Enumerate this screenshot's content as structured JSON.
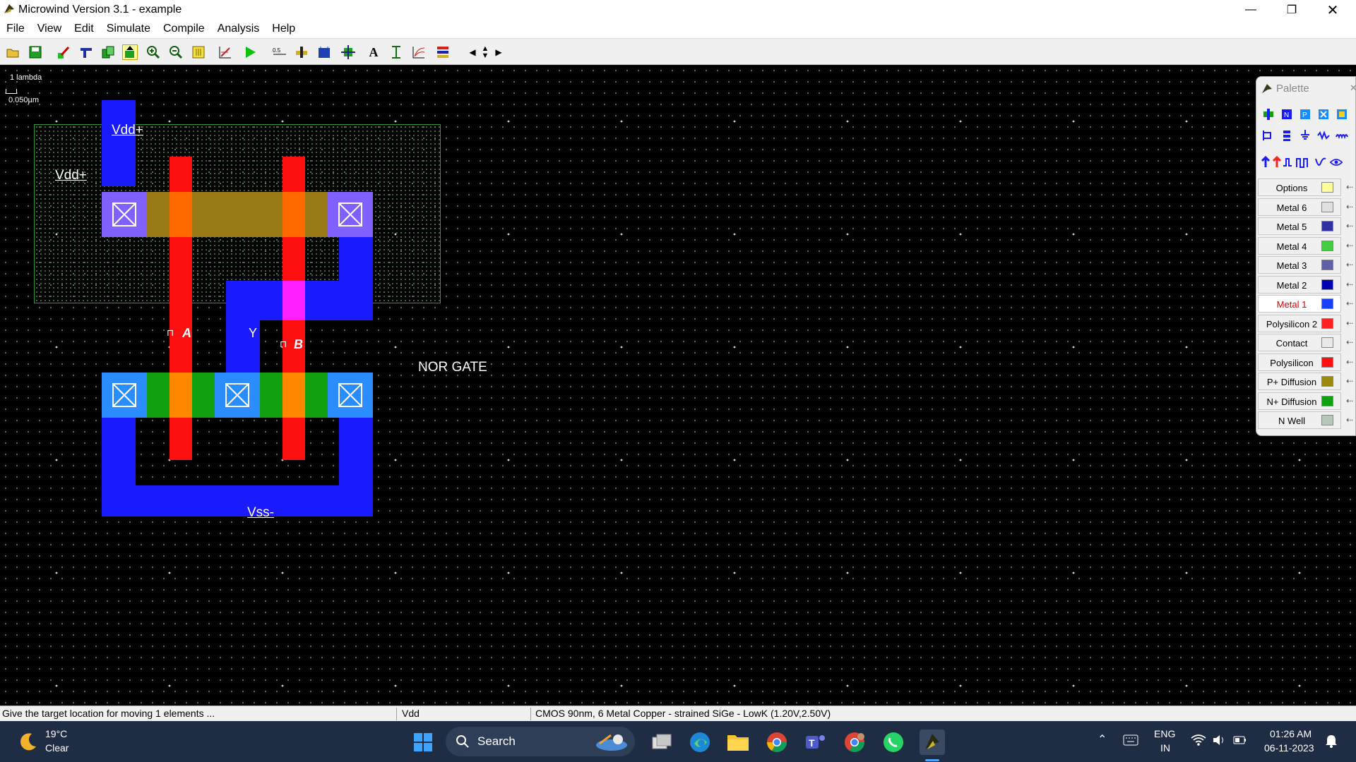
{
  "window": {
    "title": "Microwind Version 3.1 - example"
  },
  "menu": [
    "File",
    "View",
    "Edit",
    "Simulate",
    "Compile",
    "Analysis",
    "Help"
  ],
  "toolbar_icons": [
    "open-icon",
    "save-icon",
    "edit-icon",
    "connect-icon",
    "copy-icon",
    "move-icon",
    "zoom-in-icon",
    "zoom-out-icon",
    "view-all-icon",
    "2d-view-icon",
    "run-icon",
    "measure-icon",
    "mos-generator-icon",
    "3d-view-icon",
    "process-icon",
    "text-icon",
    "vertical-aspect-icon",
    "ports-icon",
    "cut-icon",
    "scroll-left-icon",
    "scroll-up-down-icon",
    "scroll-right-icon"
  ],
  "scale": {
    "lambda": "1 lambda",
    "micron": "0.050µm"
  },
  "layout_labels": {
    "vdd_top": "Vdd+",
    "vdd_left": "Vdd+",
    "input_a": "A",
    "output_y": "Y",
    "input_b": "B",
    "vss": "Vss-",
    "title": "NOR GATE"
  },
  "palette": {
    "title": "Palette",
    "items": [
      {
        "label": "Options",
        "color": "#ffff99"
      },
      {
        "label": "Metal 6",
        "color": "#e0e0e0"
      },
      {
        "label": "Metal 5",
        "color": "#3030a0"
      },
      {
        "label": "Metal 4",
        "color": "#44cc44"
      },
      {
        "label": "Metal 3",
        "color": "#6060a8"
      },
      {
        "label": "Metal 2",
        "color": "#0000b0"
      },
      {
        "label": "Metal 1",
        "color": "#1a40ff"
      },
      {
        "label": "Polysilicon 2",
        "color": "#ff2020"
      },
      {
        "label": "Contact",
        "color": "#e8e8e8"
      },
      {
        "label": "Polysilicon",
        "color": "#ff1010"
      },
      {
        "label": "P+ Diffusion",
        "color": "#9a8a10"
      },
      {
        "label": "N+ Diffusion",
        "color": "#10a010"
      },
      {
        "label": "N Well",
        "color": "#b8c8b8"
      }
    ],
    "selected": "Metal 1"
  },
  "status": {
    "message": "Give the target location for moving 1 elements ...",
    "node": "Vdd",
    "technology": "CMOS 90nm, 6 Metal Copper - strained SiGe - LowK (1.20V,2.50V)"
  },
  "taskbar": {
    "weather_temp": "19°C",
    "weather_desc": "Clear",
    "search": "Search",
    "lang_top": "ENG",
    "lang_bottom": "IN",
    "time": "01:26 AM",
    "date": "06-11-2023"
  },
  "colors": {
    "metal1": "#1a1aff",
    "poly": "#ff1010",
    "ndiff": "#10a010",
    "nwell_border": "#2e9a2e",
    "contact_bg": "#2b8cff"
  }
}
